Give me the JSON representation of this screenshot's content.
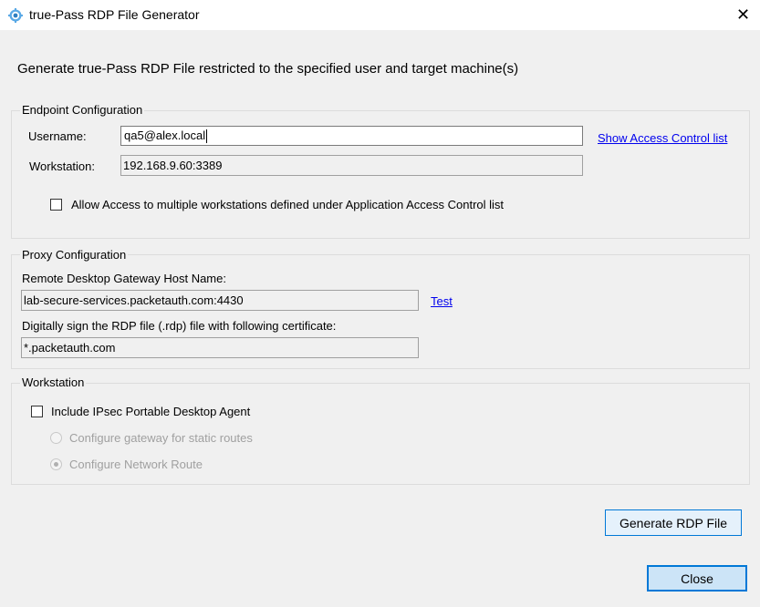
{
  "window": {
    "title": "true-Pass RDP File Generator",
    "close_glyph": "✕",
    "icon": "gear-icon"
  },
  "heading": "Generate true-Pass RDP File restricted to the specified user and target machine(s)",
  "endpoint": {
    "group_title": "Endpoint Configuration",
    "username_label": "Username:",
    "username_value": "qa5@alex.local",
    "workstation_label": "Workstation:",
    "workstation_value": "192.168.9.60:3389",
    "show_acl_link": "Show Access Control list",
    "multi_checkbox_label": "Allow Access to multiple workstations defined under Application Access Control list",
    "multi_checked": false
  },
  "proxy": {
    "group_title": "Proxy Configuration",
    "gateway_label": "Remote Desktop Gateway Host Name:",
    "gateway_value": "lab-secure-services.packetauth.com:4430",
    "test_link": "Test",
    "cert_label": "Digitally sign the RDP file (.rdp) file with following certificate:",
    "cert_value": "*.packetauth.com"
  },
  "workstation": {
    "group_title": "Workstation",
    "ipsec_label": "Include IPsec Portable Desktop Agent",
    "ipsec_checked": false,
    "radio_static_label": "Configure gateway for static routes",
    "radio_network_label": "Configure Network Route",
    "selected_radio": "Configure Network Route"
  },
  "buttons": {
    "generate": "Generate RDP File",
    "close": "Close"
  }
}
